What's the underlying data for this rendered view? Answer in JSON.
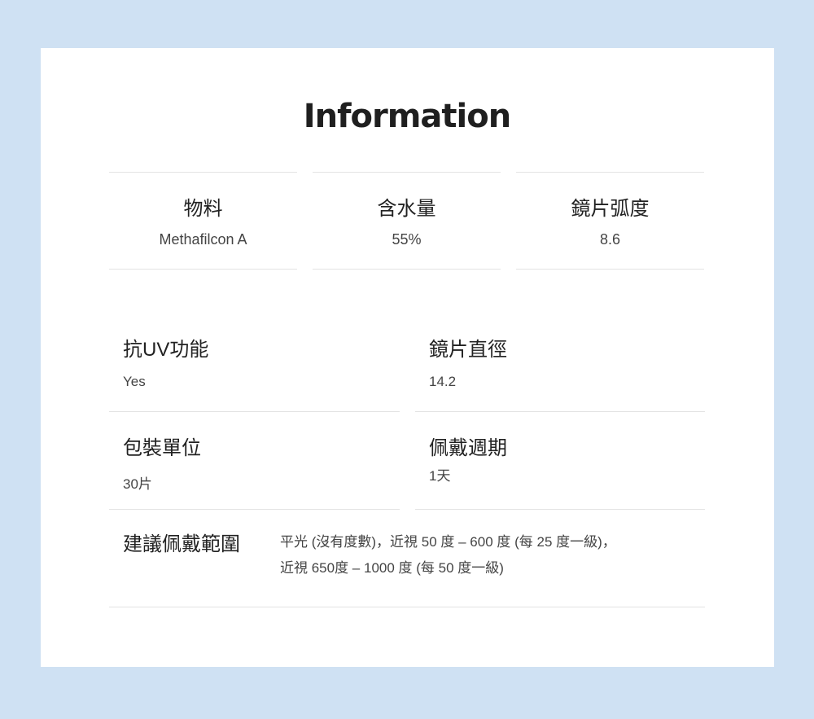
{
  "title": "Information",
  "specs": [
    {
      "label": "物料",
      "value": "Methafilcon A"
    },
    {
      "label": "含水量",
      "value": "55%"
    },
    {
      "label": "鏡片弧度",
      "value": "8.6"
    }
  ],
  "details": [
    {
      "label": "抗UV功能",
      "value": "Yes"
    },
    {
      "label": "鏡片直徑",
      "value": "14.2"
    },
    {
      "label": "包裝單位",
      "value": "30片"
    },
    {
      "label": "佩戴週期",
      "value": "1天"
    }
  ],
  "range": {
    "label": "建議佩戴範圍",
    "line1": "平光 (沒有度數)，近視 50 度 – 600 度 (每 25 度一級)，",
    "line2": "近視 650度 – 1000 度 (每 50 度一級)"
  }
}
